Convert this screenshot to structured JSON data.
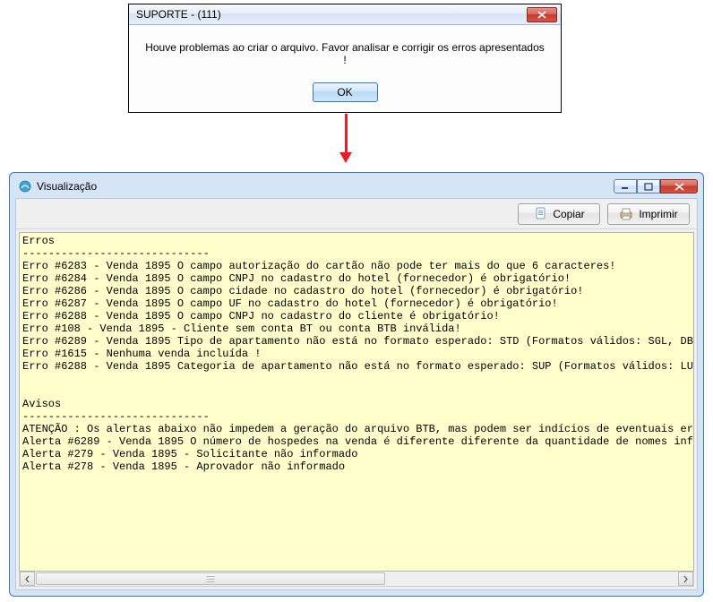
{
  "dialog1": {
    "title": "SUPORTE - (111)",
    "message": "Houve problemas ao criar o arquivo. Favor analisar e corrigir os erros apresentados !",
    "ok_label": "OK"
  },
  "dialog2": {
    "title": "Visualização",
    "icon_name": "app-icon",
    "toolbar": {
      "copy_label": "Copiar",
      "print_label": "Imprimir"
    },
    "content": {
      "errors_header": "Erros",
      "errors_divider": "-----------------------------",
      "errors": [
        "Erro #6283 - Venda 1895 O campo autorização do cartão não pode ter mais do que 6 caracteres!",
        "Erro #6284 - Venda 1895 O campo CNPJ no cadastro do hotel (fornecedor) é obrigatório!",
        "Erro #6286 - Venda 1895 O campo cidade no cadastro do hotel (fornecedor) é obrigatório!",
        "Erro #6287 - Venda 1895 O campo UF no cadastro do hotel (fornecedor) é obrigatório!",
        "Erro #6288 - Venda 1895 O campo CNPJ no cadastro do cliente é obrigatório!",
        "Erro #108 - Venda 1895 - Cliente sem conta BT ou conta BTB inválida!",
        "Erro #6289 - Venda 1895 Tipo de apartamento não está no formato esperado: STD (Formatos válidos: SGL, DB",
        "Erro #1615 - Nenhuma venda incluída !",
        "Erro #6288 - Venda 1895 Categoria de apartamento não está no formato esperado: SUP (Formatos válidos: LU"
      ],
      "warnings_header": "Avisos",
      "warnings_divider": "-----------------------------",
      "warnings_note": "ATENÇÃO : Os alertas abaixo não impedem a geração do arquivo BTB, mas podem ser indícios de eventuais er",
      "warnings": [
        "Alerta #6289 - Venda 1895 O número de hospedes na venda é diferente diferente da quantidade de nomes inf",
        "Alerta #279 - Venda 1895 - Solicitante não informado",
        "Alerta #278 - Venda 1895 - Aprovador não informado"
      ]
    }
  }
}
